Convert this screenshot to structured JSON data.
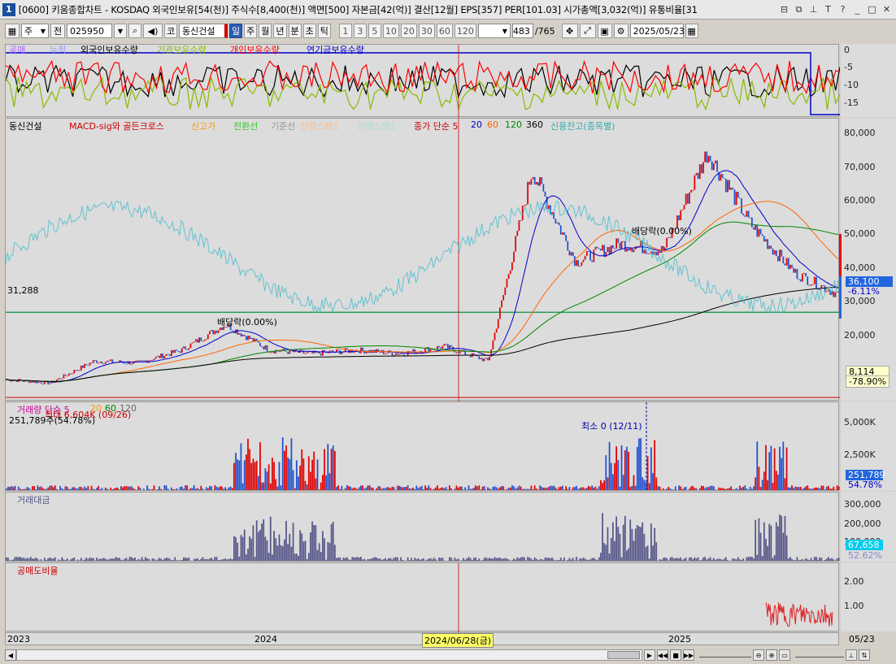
{
  "window": {
    "number": "1",
    "title": "[0600] 키움종합차트 - KOSDAQ 외국인보유[54(천)] 주식수[8,400(천)] 액면[500] 자본금[42(억)] 결산[12월] EPS[357] PER[101.03] 시가총액[3,032(억)] 유통비율[31",
    "icons": [
      "restore-icon",
      "copy-icon",
      "pin-icon",
      "text-icon",
      "help-icon",
      "minimize-icon",
      "maximize-icon",
      "close-icon"
    ]
  },
  "toolbar": {
    "period_type": "주",
    "prev_label": "전",
    "stock_code": "025950",
    "market_label": "코",
    "stock_name": "동신건설",
    "period_buttons": [
      "일",
      "주",
      "월",
      "년",
      "분",
      "초",
      "틱"
    ],
    "active_period": "일",
    "interval_buttons": [
      "1",
      "3",
      "5",
      "10",
      "20",
      "30",
      "60",
      "120"
    ],
    "counter": "483",
    "counter_total": "/765",
    "date": "2025/05/23"
  },
  "top_panel": {
    "legend": [
      "공매",
      "누적",
      "외국인보유수량",
      "기관보유수량",
      "개인보유수량",
      "연기금보유수량"
    ],
    "axis_ticks": [
      "0",
      "-5",
      "-10",
      "-15"
    ],
    "colors": {
      "foreign": "#000000",
      "institution": "#88bb00",
      "individual": "#ff0000",
      "pension": "#0000cc"
    }
  },
  "price_panel": {
    "legend": {
      "name": "동신건설",
      "macd": "MACD-sig와 골든크로스",
      "new_high": "신고가",
      "conversion": "전환선",
      "base": "기준선",
      "span1": "선행스팬1",
      "span2": "선행스팬2",
      "ma_title": "종가 단순 5",
      "ma_periods": [
        "20",
        "60",
        "120",
        "360"
      ],
      "credit": "신용잔고(종목별)"
    },
    "axis_ticks": [
      "80,000",
      "70,000",
      "60,000",
      "50,000",
      "40,000",
      "30,000",
      "20,000"
    ],
    "hline_label": "31,288",
    "current_price": "36,100",
    "current_change": "-6.11%",
    "low_price": "8,114",
    "low_change": "-78.90%",
    "annotations": [
      "배당락(0.00%)",
      "배당락(0.00%)"
    ],
    "chart_data": {
      "type": "line",
      "title": "동신건설",
      "x": [
        "2023",
        "2024",
        "2025"
      ],
      "ylim": [
        7000,
        84000
      ],
      "series": [
        {
          "name": "종가",
          "values": [
            13000,
            12000,
            18000,
            17500,
            21000,
            28000,
            21000,
            20000,
            21000,
            20000,
            22000,
            18000,
            70000,
            45000,
            50000,
            48000,
            75000,
            55000,
            42000,
            36100
          ]
        }
      ]
    }
  },
  "volume_panel": {
    "legend": "거래량 단순 5",
    "legend_periods": [
      "20",
      "60",
      "120"
    ],
    "max_label": "최대 6,604K (09/26)",
    "min_label": "최소 0 (12/11)",
    "current_label": "251,789주(54.78%)",
    "axis_ticks": [
      "5,000K",
      "2,500K"
    ],
    "badge_value": "251,789",
    "badge_pct": "54.78%"
  },
  "amount_panel": {
    "legend": "거래대금",
    "axis_ticks": [
      "300,000",
      "200,000",
      "100,000"
    ],
    "badge_value": "67,658",
    "badge_pct": "52.62%"
  },
  "short_panel": {
    "legend": "공매도비율",
    "axis_ticks": [
      "2.00",
      "1.00"
    ]
  },
  "x_axis": {
    "labels": [
      "2023",
      "2024",
      "2025"
    ],
    "cursor_date": "2024/06/28(금)",
    "end_label": "05/23"
  }
}
